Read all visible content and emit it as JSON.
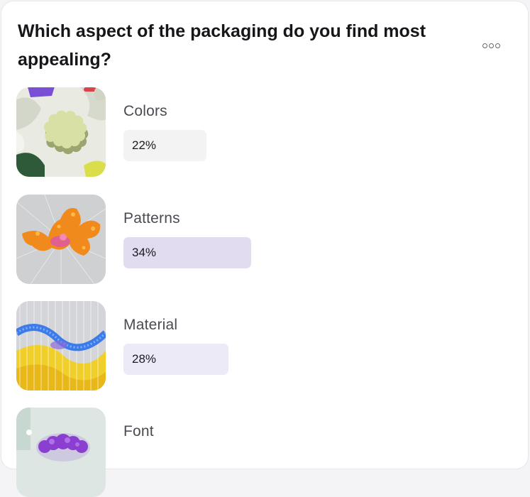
{
  "poll": {
    "question": "Which aspect of the packaging do you find most appealing?",
    "options": [
      {
        "label": "Colors",
        "percent": "22%",
        "value": 22,
        "bar_color": "#f3f3f4",
        "thumb": "clay-shapes-image"
      },
      {
        "label": "Patterns",
        "percent": "34%",
        "value": 34,
        "bar_color": "#e1dcef",
        "thumb": "orange-coral-image"
      },
      {
        "label": "Material",
        "percent": "28%",
        "value": 28,
        "bar_color": "#eceaf7",
        "thumb": "wave-strings-image"
      },
      {
        "label": "Font",
        "percent": "",
        "value": null,
        "bar_color": "#f3f3f4",
        "thumb": "purple-bloom-image"
      }
    ]
  },
  "icons": {
    "more": "more-options-icon"
  }
}
